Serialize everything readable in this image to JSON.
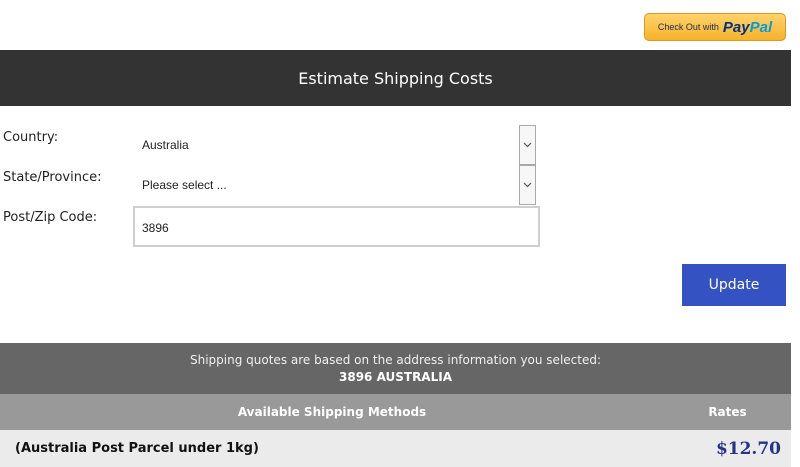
{
  "paypal": {
    "prefix": "Check Out with",
    "brand_pay": "Pay",
    "brand_pal": "Pal"
  },
  "header": {
    "title": "Estimate Shipping Costs"
  },
  "form": {
    "country_label": "Country:",
    "country_value": "Australia",
    "state_label": "State/Province:",
    "state_value": "Please select ...",
    "zip_label": "Post/Zip Code:",
    "zip_value": "3896",
    "update_label": "Update"
  },
  "quotes": {
    "note": "Shipping quotes are based on the address information you selected:",
    "address": "3896 AUSTRALIA"
  },
  "methods": {
    "col_method": "Available Shipping Methods",
    "col_rates": "Rates",
    "rows": [
      {
        "name": "(Australia Post Parcel under 1kg)",
        "rate": "$12.70"
      }
    ]
  },
  "icons": {
    "dropdown": "chevron-down-icon"
  }
}
